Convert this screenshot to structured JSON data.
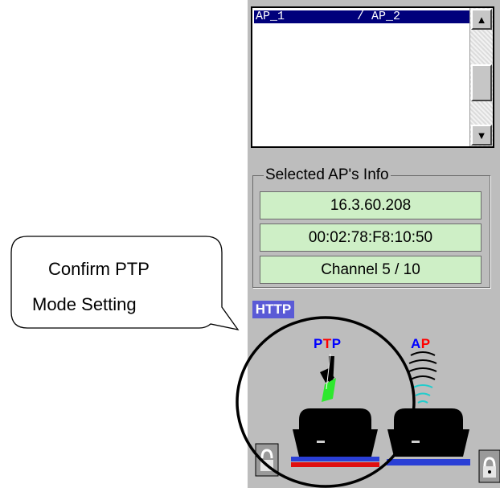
{
  "ap_list": {
    "selected_row": "AP_1          / AP_2"
  },
  "selected_info": {
    "legend": "Selected AP's Info",
    "ip": "16.3.60.208",
    "mac": "00:02:78:F8:10:50",
    "channel": "Channel 5 / 10"
  },
  "protocol_badge": "HTTP",
  "modes": {
    "ptp": {
      "letters": [
        "P",
        "T",
        "P"
      ],
      "colors": [
        "#0000ff",
        "#ff0000",
        "#0000ff"
      ]
    },
    "ap": {
      "letters": [
        "A",
        "P"
      ],
      "colors": [
        "#0000ff",
        "#ff0000"
      ]
    }
  },
  "callout": {
    "line1": "Confirm PTP",
    "line2": "Mode Setting"
  },
  "icons": {
    "scroll_up": "arrow-up-icon",
    "scroll_down": "arrow-down-icon",
    "ptp_signal": "ptp-link-icon",
    "ap_signal": "wireless-signal-icon",
    "device": "access-point-device-icon",
    "lock": "lock-icon"
  },
  "colors": {
    "panel_bg": "#bdbdbd",
    "selection": "#00007b",
    "info_field_bg": "#ceefc6",
    "badge_bg": "#5a5ad6",
    "ptp_bar": "#e01010",
    "ap_bar": "#2a3fd6"
  }
}
